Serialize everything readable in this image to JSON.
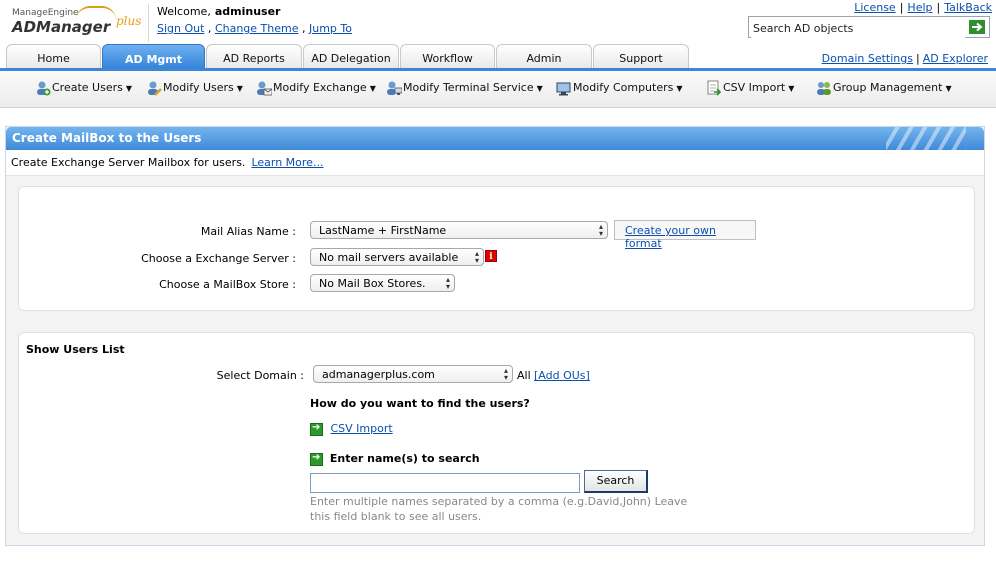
{
  "header": {
    "brand_small": "ManageEngine",
    "brand_main": "ADManager",
    "brand_plus": "plus",
    "welcome_label": "Welcome,",
    "username": "adminuser",
    "links": [
      "Sign Out",
      "Change Theme",
      "Jump To"
    ],
    "top_links": [
      "License",
      "Help",
      "TalkBack"
    ],
    "search_placeholder": "Search AD objects"
  },
  "tabs": [
    {
      "label": "Home",
      "active": false
    },
    {
      "label": "AD Mgmt",
      "active": true
    },
    {
      "label": "AD Reports",
      "active": false
    },
    {
      "label": "AD Delegation",
      "active": false
    },
    {
      "label": "Workflow",
      "active": false
    },
    {
      "label": "Admin",
      "active": false
    },
    {
      "label": "Support",
      "active": false
    }
  ],
  "domain_links": [
    "Domain Settings",
    "AD Explorer"
  ],
  "submenu": [
    {
      "label": "Create Users",
      "icon": "create-users-icon"
    },
    {
      "label": "Modify Users",
      "icon": "modify-users-icon"
    },
    {
      "label": "Modify Exchange",
      "icon": "modify-exchange-icon"
    },
    {
      "label": "Modify Terminal Service",
      "icon": "terminal-service-icon"
    },
    {
      "label": "Modify Computers",
      "icon": "computers-icon"
    },
    {
      "label": "CSV Import",
      "icon": "csv-import-icon"
    },
    {
      "label": "Group Management",
      "icon": "group-management-icon"
    }
  ],
  "panel": {
    "title": "Create MailBox to the Users",
    "description": "Create Exchange Server Mailbox for users.",
    "learn_more": "Learn More..."
  },
  "mailbox_form": {
    "alias_label": "Mail Alias Name :",
    "alias_value": "LastName + FirstName",
    "create_format": "Create your own format",
    "server_label": "Choose a Exchange Server :",
    "server_value": "No mail servers available",
    "store_label": "Choose a MailBox Store :",
    "store_value": "No Mail Box Stores."
  },
  "users_list": {
    "heading": "Show Users List",
    "domain_label": "Select Domain :",
    "domain_value": "admanagerplus.com",
    "all_label": "All",
    "add_ous": "[Add OUs]",
    "find_question": "How do you want to find the users?",
    "csv_import": "CSV Import",
    "enter_names": "Enter name(s) to search",
    "search_value": "",
    "search_button": "Search",
    "hint": "Enter multiple names separated by a comma (e.g.David,John) Leave this field blank to see all users."
  }
}
